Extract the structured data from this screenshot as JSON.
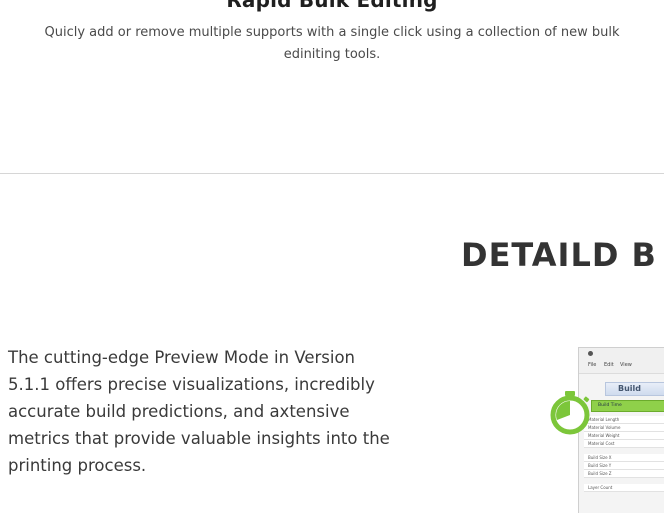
{
  "feature": {
    "title": "Rapid Bulk Editing",
    "description": "Quicly add or remove multiple supports with a single click using a collection of new bulk ediniting tools."
  },
  "section": {
    "heading": "DETAILD B",
    "body": "The cutting-edge Preview Mode in Version 5.1.1 offers precise visualizations, incredibly accurate build predictions, and axtensive metrics that provide valuable insights into the printing process."
  },
  "thumbnail": {
    "menus": [
      "File",
      "Edit",
      "View"
    ],
    "panel_title": "Build",
    "highlight_row": "Build Time",
    "rows": [
      "Material Length",
      "Material Volume",
      "Material Weight",
      "Material Cost"
    ],
    "rows2": [
      "Build Size X",
      "Build Size Y",
      "Build Size Z"
    ],
    "rows3": [
      "Layer Count"
    ],
    "accent": "#8fd04a"
  }
}
